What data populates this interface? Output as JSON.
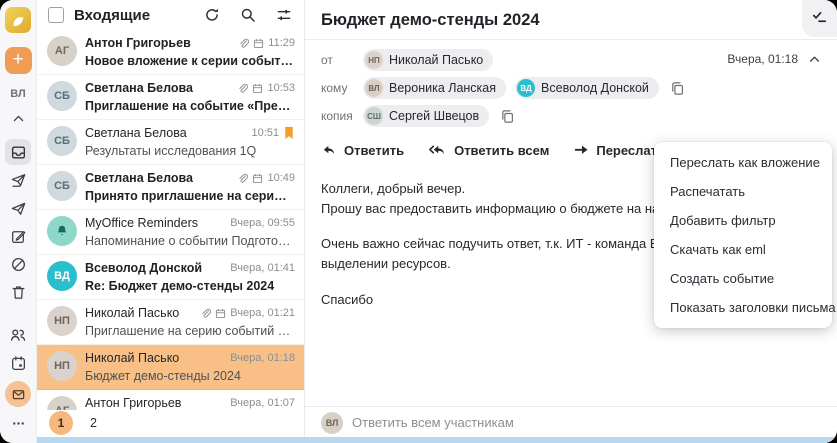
{
  "sidebar": {
    "user_initials": "ВЛ",
    "plus_label": "+",
    "folders": [
      "inbox",
      "sent",
      "outbox",
      "drafts",
      "spam",
      "trash"
    ],
    "apps": [
      "contacts",
      "calendar",
      "mail",
      "more"
    ]
  },
  "list": {
    "title": "Входящие",
    "emails": [
      {
        "sender": "Антон Григорьев",
        "subject": "Новое вложение к серии событий «Аналити…",
        "time": "11:29",
        "unread": true,
        "attachment": true,
        "event": true,
        "initials": "АГ"
      },
      {
        "sender": "Светлана Белова",
        "subject": "Приглашение на событие «Предварительно…",
        "time": "10:53",
        "unread": true,
        "attachment": true,
        "event": true,
        "initials": "СБ"
      },
      {
        "sender": "Светлана Белова",
        "subject": "Результаты исследования 1Q",
        "time": "10:51",
        "unread": false,
        "flagged": true,
        "initials": "СБ"
      },
      {
        "sender": "Светлана Белова",
        "subject": "Принято приглашение на серию событий «…",
        "time": "10:49",
        "unread": true,
        "attachment": true,
        "event": true,
        "initials": "СБ"
      },
      {
        "sender": "MyOffice Reminders",
        "subject": "Напоминание о событии Подготовить отчет…",
        "time": "Вчера, 09:55",
        "unread": false,
        "initials": "🔔"
      },
      {
        "sender": "Всеволод Донской",
        "subject": "Re: Бюджет демо-стенды 2024",
        "time": "Вчера, 01:41",
        "unread": true,
        "initials": "ВД"
      },
      {
        "sender": "Николай Пасько",
        "subject": "Приглашение на серию событий «Демо стен…",
        "time": "Вчера, 01:21",
        "unread": false,
        "attachment": true,
        "event": true,
        "initials": "НП"
      },
      {
        "sender": "Николай Пасько",
        "subject": "Бюджет демо-стенды 2024",
        "time": "Вчера, 01:18",
        "unread": false,
        "selected": true,
        "initials": "НП"
      },
      {
        "sender": "Антон Григорьев",
        "subject": "",
        "time": "Вчера, 01:07",
        "unread": false,
        "initials": "АГ"
      }
    ],
    "pagination": {
      "pages": [
        "1",
        "2"
      ],
      "active": "1"
    }
  },
  "reader": {
    "subject": "Бюджет демо-стенды 2024",
    "date": "Вчера, 01:18",
    "meta": {
      "from_label": "от",
      "to_label": "кому",
      "cc_label": "копия"
    },
    "from": {
      "name": "Николай Пасько",
      "initials": "НП"
    },
    "to": [
      {
        "name": "Вероника Ланская",
        "initials": "ВЛ"
      },
      {
        "name": "Всеволод Донской",
        "initials": "ВД"
      }
    ],
    "cc": [
      {
        "name": "Сергей Швецов",
        "initials": "СШ"
      }
    ],
    "toolbar": {
      "reply": "Ответить",
      "reply_all": "Ответить всем",
      "forward": "Переслать"
    },
    "body": [
      "Коллеги, добрый вечер.",
      "Прошу вас предоставить информацию о бюджете на наши демонстраци",
      "Очень важно сейчас подучить ответ, т.к. ИТ - команда Всеволода, уже",
      "выделении ресурсов.",
      "Спасибо"
    ],
    "reply_placeholder": "Ответить всем участникам"
  },
  "menu": {
    "items": [
      "Переслать как вложение",
      "Распечатать",
      "Добавить фильтр",
      "Скачать как eml",
      "Создать событие",
      "Показать заголовки письма"
    ]
  },
  "colors": {
    "accent_orange": "#F09C54",
    "selected_row": "#F8BF86",
    "pagination_active": "#F5B87E",
    "flag_orange": "#F59E2D",
    "teal_avatar": "#2BBECD",
    "reminder_mint": "#8ED8C9",
    "bottom_strip_blue": "#B7D8EE"
  }
}
